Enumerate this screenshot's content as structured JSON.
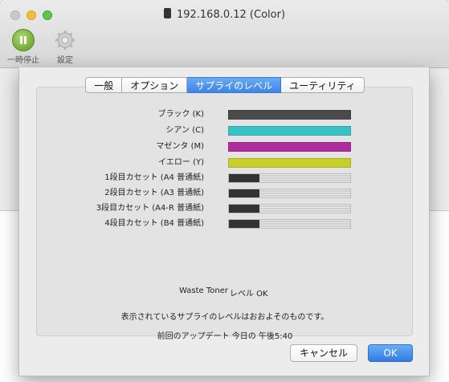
{
  "window": {
    "title": "192.168.0.12 (Color)",
    "toolbar": {
      "pause_label": "一時停止",
      "settings_label": "設定"
    }
  },
  "tabs": [
    {
      "label": "一般",
      "active": false
    },
    {
      "label": "オプション",
      "active": false
    },
    {
      "label": "サプライのレベル",
      "active": true
    },
    {
      "label": "ユーティリティ",
      "active": false
    }
  ],
  "supplies": [
    {
      "label": "ブラック (K)",
      "color": "#4a4a4a",
      "level": 1.0
    },
    {
      "label": "シアン (C)",
      "color": "#37c3c6",
      "level": 1.0
    },
    {
      "label": "マゼンタ (M)",
      "color": "#b22d9c",
      "level": 1.0
    },
    {
      "label": "イエロー (Y)",
      "color": "#c9cf2a",
      "level": 1.0
    }
  ],
  "trays": [
    {
      "label": "1段目カセット (A4 普通紙)",
      "level": 0.25
    },
    {
      "label": "2段目カセット (A3 普通紙)",
      "level": 0.25
    },
    {
      "label": "3段目カセット (A4-R 普通紙)",
      "level": 0.25
    },
    {
      "label": "4段目カセット (B4 普通紙)",
      "level": 0.25
    }
  ],
  "waste_toner": {
    "label": "Waste Toner",
    "value": "レベル OK"
  },
  "note": "表示されているサプライのレベルはおおよそのものです。",
  "last_update": "前回のアップデート 今日の 午後5:40",
  "buttons": {
    "cancel": "キャンセル",
    "ok": "OK"
  },
  "colors": {
    "accent": "#3d86e6"
  }
}
